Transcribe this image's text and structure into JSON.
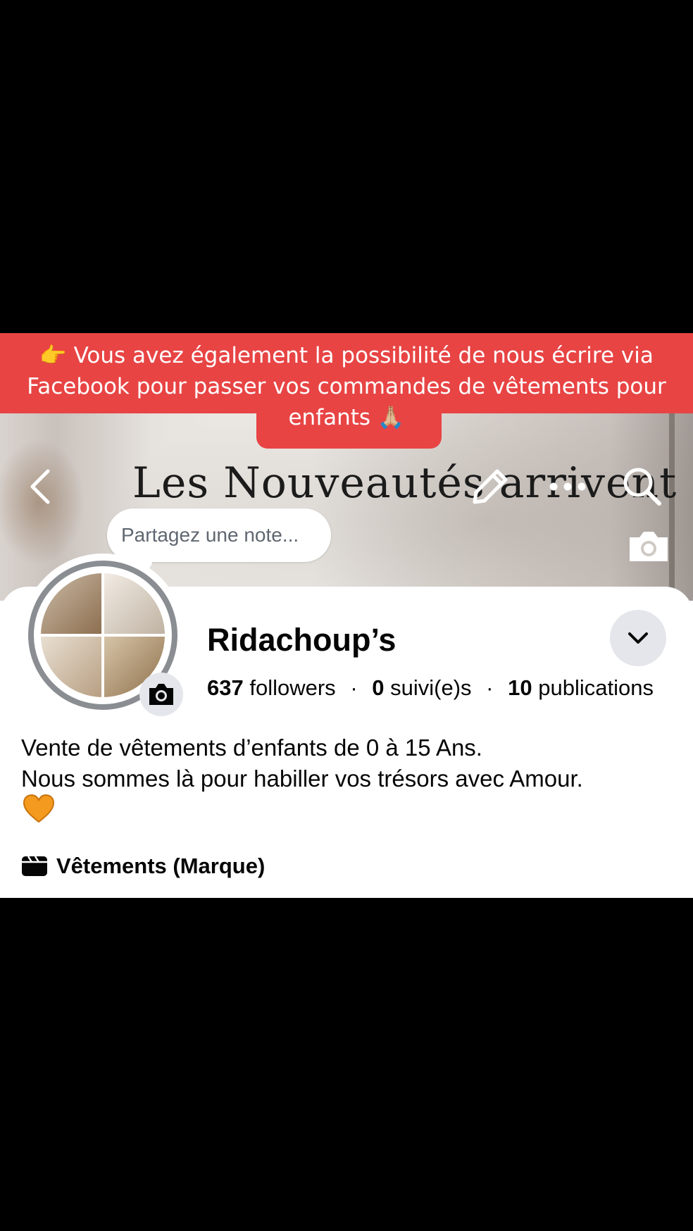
{
  "banner": {
    "line1": "👉 Vous avez également la possibilité de nous écrire via",
    "line2": "Facebook pour passer vos commandes de vêtements pour",
    "line3": "enfants 🙏🏼",
    "color": "#e84444"
  },
  "cover": {
    "title": "Les Nouveautés arrivent"
  },
  "header_icons": [
    "back-icon",
    "edit-icon",
    "more-icon",
    "search-icon"
  ],
  "note": {
    "placeholder": "Partagez une note..."
  },
  "profile": {
    "name": "Ridachoup’s",
    "followers_count": "637",
    "followers_label": "followers",
    "following_count": "0",
    "following_label": "suivi(e)s",
    "posts_count": "10",
    "posts_label": "publications",
    "separator": "·"
  },
  "bio": {
    "line1": "Vente de vêtements d’enfants de 0 à 15 Ans.",
    "line2": "Nous sommes là pour habiller vos trésors avec Amour."
  },
  "category": {
    "label": "Vêtements (Marque)"
  },
  "colors": {
    "text": "#050505",
    "secondary_text": "#606770",
    "button_bg": "#e4e6eb",
    "heart": "#f39a1f"
  }
}
